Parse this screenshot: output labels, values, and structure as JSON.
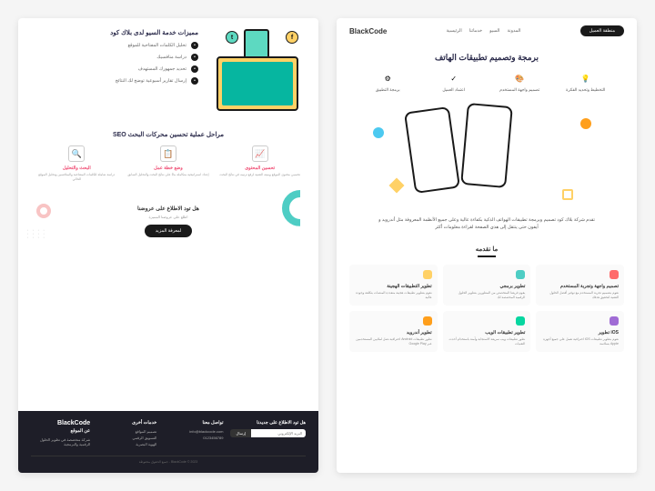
{
  "brand": "BlackCode",
  "nav": {
    "items": [
      "الرئيسية",
      "خدماتنا",
      "السيو",
      "المدونة"
    ],
    "cta": "منطقة العميل"
  },
  "left": {
    "hero_title": "برمجة وتصميم تطبيقات الهاتف",
    "steps": [
      {
        "icon": "💡",
        "label": "التخطيط وتحديد الفكرة"
      },
      {
        "icon": "🎨",
        "label": "تصميم واجهة المستخدم"
      },
      {
        "icon": "✓",
        "label": "اعتماد العميل"
      },
      {
        "icon": "⚙",
        "label": "برمجة التطبيق"
      }
    ],
    "description": "تقدم شركة بلاك كود تصميم وبرمجة تطبيقات الهواتف الذكية بكفاءة عالية وعلى جميع الأنظمة المعروفة مثل أندرويد و آيفون حتى ينتقل إلى هذي الصفحة لقراءة معلومات أكثر",
    "services_title": "ما نقدمه",
    "cards": [
      {
        "title": "تصميم واجهة وتجربة المستخدم",
        "desc": "نقوم بتصميم تجربة المستخدم مع توفير أفضل الحلول التقنية لتحقيق هدفك"
      },
      {
        "title": "تطوير برمجي",
        "desc": "يقوم فريقنا المتخصص من المطورين بتطوير الحلول الرقمية المخصصة لك"
      },
      {
        "title": "تطوير التطبيقات الهجينة",
        "desc": "نقوم بتطوير تطبيقات هجينة متعددة المنصات بتكلفة وجودة عالية"
      },
      {
        "title": "iOS تطوير",
        "desc": "نقوم بتطوير تطبيقات iOS احترافية تعمل على جميع أجهزة Apple بسلاسة"
      },
      {
        "title": "تطوير تطبيقات الويب",
        "desc": "نطور تطبيقات ويب سريعة الاستجابة وآمنة باستخدام أحدث التقنيات"
      },
      {
        "title": "تطوير أندرويد",
        "desc": "نطور تطبيقات Android احترافية تصل لملايين المستخدمين عبر Google Play"
      }
    ]
  },
  "right": {
    "seo_title": "مميزات خدمة السيو لدى بلاك كود",
    "seo_items": [
      "تحليل الكلمات المفتاحية للموقع",
      "دراسة منافسيك",
      "تحديد جمهورك المستهدف",
      "إرسال تقارير أسبوعية توضح لك النتائج"
    ],
    "stages_title": "مراحل عملية تحسين محركات البحث SEO",
    "stages": [
      {
        "icon": "🔍",
        "title": "البحث والتحليل",
        "desc": "دراسة شاملة للكلمات المفتاحية والمنافسين وتحليل الموقع الحالي"
      },
      {
        "icon": "📋",
        "title": "وضع خطة عمل",
        "desc": "إعداد استراتيجية متكاملة بناءً على نتائج البحث والتحليل السابق"
      },
      {
        "icon": "📈",
        "title": "تحسين المحتوى",
        "desc": "تحسين محتوى الموقع وبنيته التقنية لرفع ترتيبه في نتائج البحث"
      }
    ],
    "cta": {
      "q": "هل تود الاطلاع على عروضنا",
      "sub": "اطلع على عروضنا المميزة",
      "btn": "لمعرفة المزيد"
    },
    "footer": {
      "about_h": "عن الموقع",
      "about": "شركة متخصصة في تطوير الحلول الرقمية والبرمجية",
      "quick_h": "خدمات أخرى",
      "quick": [
        "تصميم المواقع",
        "التسويق الرقمي",
        "الهوية البصرية"
      ],
      "contact_h": "تواصل معنا",
      "email": "info@blackcode.com",
      "phone": "0123456789",
      "news_h": "هل تود الاطلاع على جديدنا",
      "placeholder": "البريد الإلكتروني",
      "send": "إرسال",
      "copy": "BlackCode © 2023 - جميع الحقوق محفوظة"
    }
  }
}
